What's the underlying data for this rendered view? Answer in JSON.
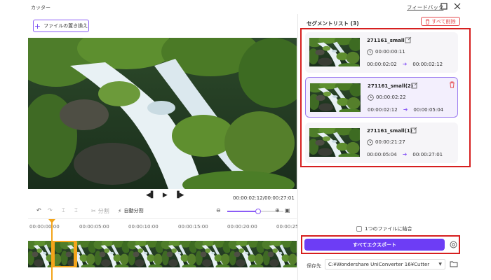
{
  "window": {
    "title": "カッター",
    "feedback": "フィードバック"
  },
  "left": {
    "replace_button": "ファイルの置き換え",
    "timecode": "00:00:02:12/00:00:27:01",
    "toolbar": {
      "split": "分割",
      "auto_split": "自動分割"
    },
    "zoom_level": 0.55,
    "ruler": [
      "00:00:00:00",
      "00:00:05:00",
      "00:00:10:00",
      "00:00:15:00",
      "00:00:20:00",
      "00:00:25"
    ]
  },
  "right": {
    "segment_list_title": "セグメントリスト (3)",
    "delete_all": "すべて削除",
    "segments": [
      {
        "name": "271161_small",
        "duration": "00:00:00:11",
        "start": "00:00:02:02",
        "end": "00:00:02:12",
        "active": false
      },
      {
        "name": "271161_small(2)",
        "duration": "00:00:02:22",
        "start": "00:00:02:12",
        "end": "00:00:05:04",
        "active": true
      },
      {
        "name": "271161_small(1)",
        "duration": "00:00:21:27",
        "start": "00:00:05:04",
        "end": "00:00:27:01",
        "active": false
      }
    ],
    "merge_label": "1つのファイルに結合",
    "export_all": "すべてエクスポート",
    "save_label": "保存先",
    "save_path": "C:¥Wondershare UniConverter 16¥Cutter"
  },
  "colors": {
    "accent": "#6d3df5",
    "highlight_red": "#d61f1f",
    "playhead": "#f3a41a",
    "danger": "#e5484d"
  },
  "icons": [
    "plus-icon",
    "prev-frame-icon",
    "play-icon",
    "next-frame-icon",
    "undo-icon",
    "redo-icon",
    "scissors-icon",
    "auto-split-icon",
    "zoom-out-icon",
    "zoom-in-icon",
    "edit-icon",
    "clock-icon",
    "trash-icon",
    "settings-icon",
    "folder-icon",
    "maximize-icon",
    "close-icon"
  ]
}
